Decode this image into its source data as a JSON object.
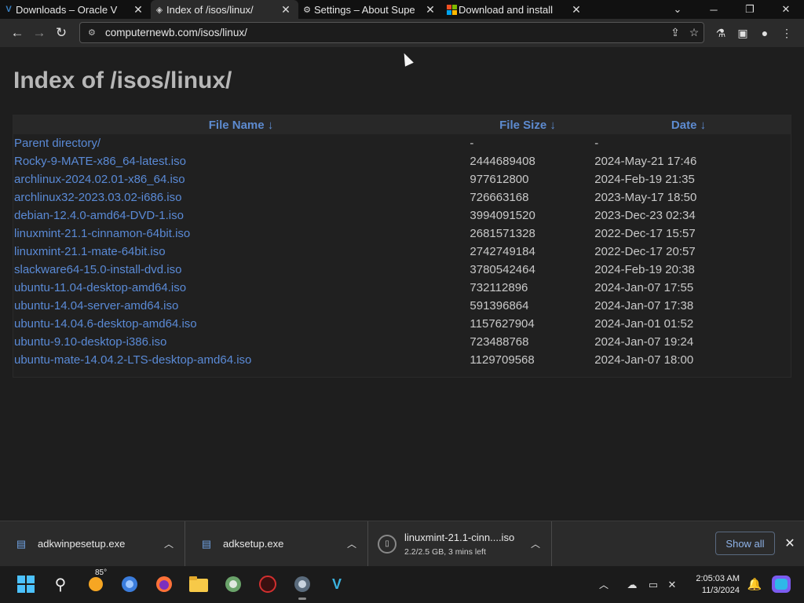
{
  "tabs": [
    {
      "title": "Downloads – Oracle V",
      "icon": "virtualbox-icon",
      "active": false
    },
    {
      "title": "Index of /isos/linux/",
      "icon": "page-icon",
      "active": true
    },
    {
      "title": "Settings – About Supe",
      "icon": "settings-gear-icon",
      "active": false
    },
    {
      "title": "Download and install",
      "icon": "microsoft-icon",
      "active": false
    }
  ],
  "toolbar": {
    "url": "computernewb.com/isos/linux/"
  },
  "page": {
    "title": "Index of /isos/linux/",
    "columns": {
      "name": "File Name  ↓",
      "size": "File Size  ↓",
      "date": "Date  ↓"
    },
    "rows": [
      {
        "name": "Parent directory/",
        "size": "-",
        "date": "-"
      },
      {
        "name": "Rocky-9-MATE-x86_64-latest.iso",
        "size": "2444689408",
        "date": "2024-May-21 17:46"
      },
      {
        "name": "archlinux-2024.02.01-x86_64.iso",
        "size": "977612800",
        "date": "2024-Feb-19 21:35"
      },
      {
        "name": "archlinux32-2023.03.02-i686.iso",
        "size": "726663168",
        "date": "2023-May-17 18:50"
      },
      {
        "name": "debian-12.4.0-amd64-DVD-1.iso",
        "size": "3994091520",
        "date": "2023-Dec-23 02:34"
      },
      {
        "name": "linuxmint-21.1-cinnamon-64bit.iso",
        "size": "2681571328",
        "date": "2022-Dec-17 15:57"
      },
      {
        "name": "linuxmint-21.1-mate-64bit.iso",
        "size": "2742749184",
        "date": "2022-Dec-17 20:57"
      },
      {
        "name": "slackware64-15.0-install-dvd.iso",
        "size": "3780542464",
        "date": "2024-Feb-19 20:38"
      },
      {
        "name": "ubuntu-11.04-desktop-amd64.iso",
        "size": "732112896",
        "date": "2024-Jan-07 17:55"
      },
      {
        "name": "ubuntu-14.04-server-amd64.iso",
        "size": "591396864",
        "date": "2024-Jan-07 17:38"
      },
      {
        "name": "ubuntu-14.04.6-desktop-amd64.iso",
        "size": "1157627904",
        "date": "2024-Jan-01 01:52"
      },
      {
        "name": "ubuntu-9.10-desktop-i386.iso",
        "size": "723488768",
        "date": "2024-Jan-07 19:24"
      },
      {
        "name": "ubuntu-mate-14.04.2-LTS-desktop-amd64.iso",
        "size": "1129709568",
        "date": "2024-Jan-07 18:00"
      }
    ]
  },
  "downloads": {
    "items": [
      {
        "name": "adkwinpesetup.exe"
      },
      {
        "name": "adksetup.exe"
      },
      {
        "name": "linuxmint-21.1-cinn....iso",
        "progress": "2.2/2.5 GB, 3 mins left"
      }
    ],
    "show_all": "Show all"
  },
  "taskbar": {
    "weather_badge": "85°",
    "time": "2:05:03 AM",
    "date": "11/3/2024"
  },
  "colors": {
    "link": "#5a8ad6",
    "header_link": "#5d8bd0",
    "background": "#1e1e1e"
  }
}
